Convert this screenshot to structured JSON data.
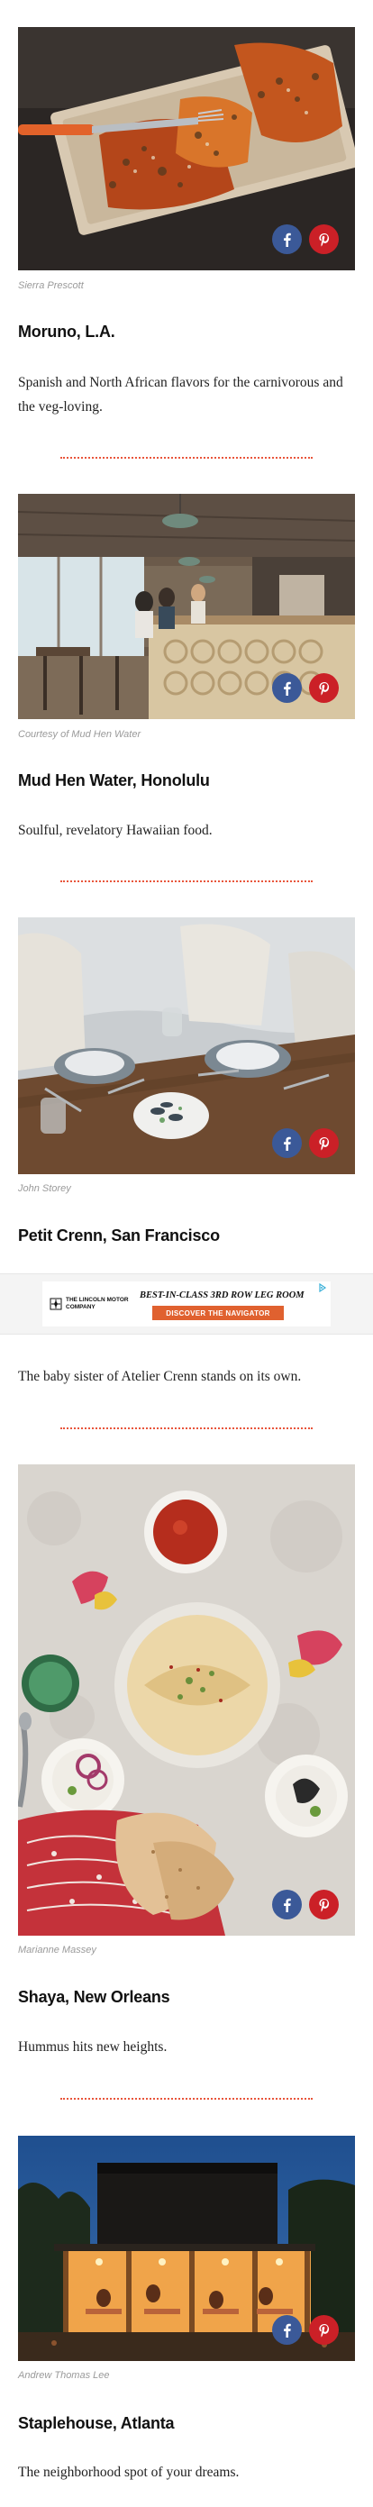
{
  "articles": [
    {
      "credit": "Sierra Prescott",
      "title": "Moruno, L.A.",
      "description": "Spanish and North African flavors for the carnivorous and the veg-loving."
    },
    {
      "credit": "Courtesy of Mud Hen Water",
      "title": "Mud Hen Water, Honolulu",
      "description": "Soulful, revelatory Hawaiian food."
    },
    {
      "credit": "John Storey",
      "title": "Petit Crenn, San Francisco",
      "description": "The baby sister of Atelier Crenn stands on its own."
    },
    {
      "credit": "Marianne Massey",
      "title": "Shaya, New Orleans",
      "description": "Hummus hits new heights."
    },
    {
      "credit": "Andrew Thomas Lee",
      "title": "Staplehouse, Atlanta",
      "description": "The neighborhood spot of your dreams."
    }
  ],
  "share": {
    "facebook_icon": "facebook-icon",
    "pinterest_icon": "pinterest-icon",
    "colors": {
      "facebook": "#3b5998",
      "pinterest": "#cb2027"
    }
  },
  "ad": {
    "brand": "THE LINCOLN MOTOR COMPANY",
    "headline": "BEST-IN-CLASS 3RD ROW LEG ROOM",
    "cta": "DISCOVER THE NAVIGATOR",
    "cta_color": "#e0612f",
    "adchoices_icon": "adchoices-icon"
  },
  "divider_color": "#e8553b"
}
